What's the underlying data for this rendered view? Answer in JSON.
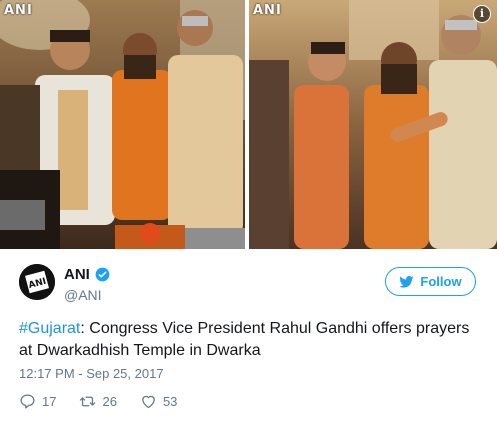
{
  "media": {
    "left_watermark": "ANI",
    "right_watermark": "ANI",
    "info_icon": "info-circle-icon"
  },
  "author": {
    "name": "ANI",
    "handle": "@ANI",
    "verified_icon": "verified-badge-icon",
    "avatar_logo_text": "ANI"
  },
  "follow_button": {
    "label": "Follow",
    "icon": "bird-icon",
    "color": "#1da1f2"
  },
  "tweet": {
    "hashtag": "#Gujarat",
    "text": ": Congress Vice President Rahul Gandhi offers prayers at Dwarkadhish Temple in Dwarka",
    "timestamp": "12:17 PM - Sep 25, 2017"
  },
  "actions": {
    "replies": "17",
    "retweets": "26",
    "likes": "53",
    "reply_icon": "reply-icon",
    "retweet_icon": "retweet-icon",
    "like_icon": "heart-icon"
  },
  "colors": {
    "link": "#1b95e0",
    "secondary_text": "#657786",
    "primary_text": "#14171a"
  }
}
